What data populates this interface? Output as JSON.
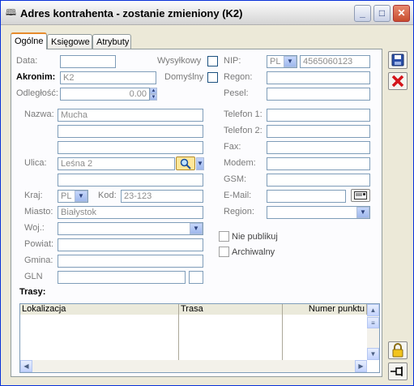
{
  "window": {
    "title": "Adres kontrahenta - zostanie zmieniony (K2)"
  },
  "tabs": [
    {
      "label": "Ogólne"
    },
    {
      "label": "Księgowe"
    },
    {
      "label": "Atrybuty"
    }
  ],
  "form": {
    "data_label": "Data:",
    "data_value": "",
    "akronim_label": "Akronim:",
    "akronim_value": "K2",
    "odleglosc_label": "Odległość:",
    "odleglosc_value": "0.00",
    "wysylkowy_label": "Wysyłkowy",
    "domyslny_label": "Domyślny",
    "nip_label": "NIP:",
    "nip_prefix": "PL",
    "nip_value": "4565060123",
    "regon_label": "Regon:",
    "regon_value": "",
    "pesel_label": "Pesel:",
    "pesel_value": "",
    "nazwa_label": "Nazwa:",
    "nazwa_value": "Mucha",
    "nazwa_line2": "",
    "nazwa_line3": "",
    "ulica_label": "Ulica:",
    "ulica_value": "Leśna 2",
    "ulica_line2": "",
    "kraj_label": "Kraj:",
    "kraj_value": "PL",
    "kod_label": "Kod:",
    "kod_value": "23-123",
    "miasto_label": "Miasto:",
    "miasto_value": "Białystok",
    "woj_label": "Woj.:",
    "woj_value": "",
    "powiat_label": "Powiat:",
    "powiat_value": "",
    "gmina_label": "Gmina:",
    "gmina_value": "",
    "gln_label": "GLN",
    "gln_value": "",
    "telefon1_label": "Telefon 1:",
    "telefon2_label": "Telefon 2:",
    "fax_label": "Fax:",
    "modem_label": "Modem:",
    "gsm_label": "GSM:",
    "email_label": "E-Mail:",
    "region_label": "Region:",
    "nie_publikuj_label": "Nie publikuj",
    "archiwalny_label": "Archiwalny"
  },
  "trasy": {
    "title": "Trasy:",
    "columns": [
      "Lokalizacja",
      "Trasa",
      "Numer punktu"
    ]
  },
  "icons": {
    "save": "save-icon",
    "cancel": "cancel-icon",
    "lock": "lock-icon",
    "pin": "pin-icon",
    "search": "search-icon",
    "email": "email-icon"
  }
}
